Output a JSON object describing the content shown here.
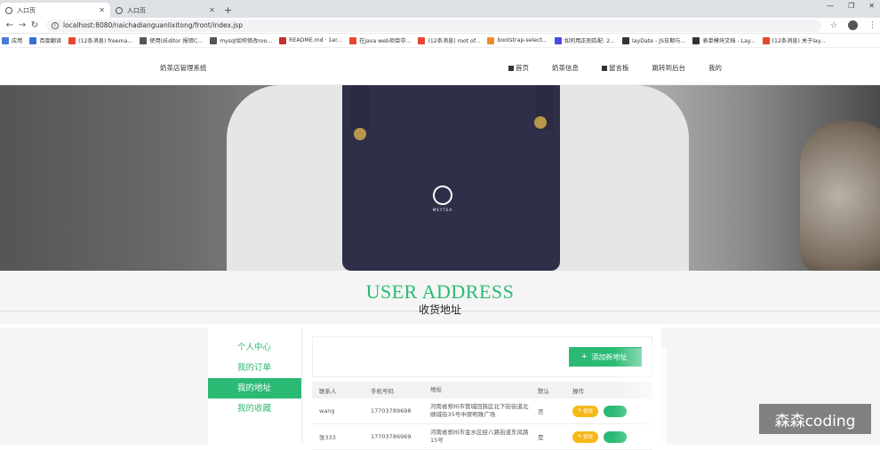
{
  "browser": {
    "tabs": [
      {
        "label": "入口页",
        "active": true
      },
      {
        "label": "入口页",
        "active": false
      }
    ],
    "new_tab": "+",
    "url": "localhost:8080/naichadianguanlixitong/front/index.jsp",
    "bookmarks": [
      {
        "label": "应用",
        "color": "#4a7bd0"
      },
      {
        "label": "百度翻译",
        "color": "#3a6fd8"
      },
      {
        "label": "(12条消息) freema...",
        "color": "#e8472f"
      },
      {
        "label": "使用UEditor 报错C...",
        "color": "#555555"
      },
      {
        "label": "mysql如何修改roo...",
        "color": "#555555"
      },
      {
        "label": "README.md · 1er...",
        "color": "#c72e2e"
      },
      {
        "label": "在java web项目中...",
        "color": "#e8472f"
      },
      {
        "label": "(12条消息) root of...",
        "color": "#e8472f"
      },
      {
        "label": "bootstrap-select...",
        "color": "#f08a2a"
      },
      {
        "label": "如何用正则匹配: 2...",
        "color": "#4a4ae0"
      },
      {
        "label": "layDate - JS日期与...",
        "color": "#333333"
      },
      {
        "label": "表单模块文档 - Lay...",
        "color": "#333333"
      },
      {
        "label": "(12条消息) 关于lay...",
        "color": "#e8472f"
      }
    ]
  },
  "site": {
    "brand": "奶茶店管理系统",
    "menu": [
      "首页",
      "奶茶信息",
      "留言板",
      "跳转到后台",
      "我的"
    ]
  },
  "hero": {
    "logo_text": "MEYTEA"
  },
  "section": {
    "title_en": "USER ADDRESS",
    "title_cn": "收货地址"
  },
  "sidebar": {
    "items": [
      {
        "label": "个人中心",
        "active": false
      },
      {
        "label": "我的订单",
        "active": false
      },
      {
        "label": "我的地址",
        "active": true
      },
      {
        "label": "我的收藏",
        "active": false
      }
    ]
  },
  "address": {
    "add_label": "添加新地址",
    "columns": [
      "联系人",
      "手机号码",
      "地址",
      "默认",
      "操作"
    ],
    "rows": [
      {
        "name": "wang",
        "phone": "17703789698",
        "address": "河南省郑州市管城回族区北下街街道北顺城街35号中原明珠广场",
        "default": "否",
        "edit": "修改"
      },
      {
        "name": "张333",
        "phone": "17703786969",
        "address": "河南省郑州市金水区经八路街道东风路15号",
        "default": "是",
        "edit": "修改"
      }
    ]
  },
  "watermark": "森森coding",
  "colors": {
    "accent": "#2bba74",
    "edit": "#f6b91a"
  }
}
